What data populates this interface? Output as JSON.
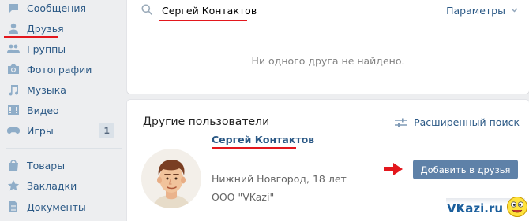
{
  "sidebar": {
    "items": [
      {
        "label": "Сообщения",
        "icon": "messages-icon"
      },
      {
        "label": "Друзья",
        "icon": "friends-icon",
        "active": true
      },
      {
        "label": "Группы",
        "icon": "groups-icon"
      },
      {
        "label": "Фотографии",
        "icon": "camera-icon"
      },
      {
        "label": "Музыка",
        "icon": "music-icon"
      },
      {
        "label": "Видео",
        "icon": "video-icon"
      },
      {
        "label": "Игры",
        "icon": "gamepad-icon",
        "badge": "1"
      },
      {
        "label": "Товары",
        "icon": "bag-icon"
      },
      {
        "label": "Закладки",
        "icon": "star-icon"
      },
      {
        "label": "Документы",
        "icon": "document-icon"
      }
    ]
  },
  "search": {
    "value": "Сергей Контактов",
    "params_label": "Параметры",
    "empty_text": "Ни одного друга не найдено."
  },
  "other_users": {
    "title": "Другие пользователи",
    "advanced_search": "Расширенный поиск",
    "user": {
      "name": "Сергей Контактов",
      "location": "Нижний Новгород, 18 лет",
      "company": "ООО \"VKazi\""
    },
    "add_button": "Добавить в друзья"
  },
  "watermark": "VKazi.ru",
  "colors": {
    "link": "#2a5885",
    "button": "#5e81a8",
    "annotation": "#e3171d",
    "background": "#edeef0"
  }
}
